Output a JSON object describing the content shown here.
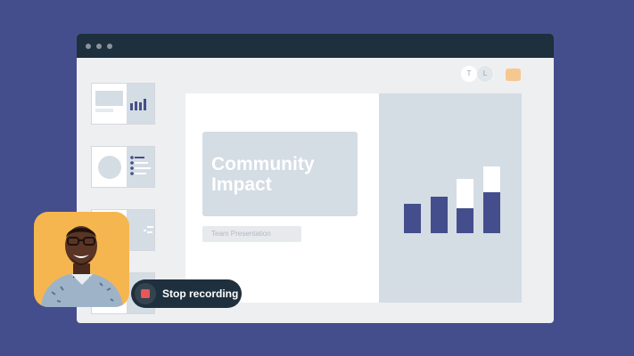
{
  "colors": {
    "background": "#454e8c",
    "window": "#eeeff1",
    "titlebar": "#1e2f3d",
    "slide_accent": "#d4dce4",
    "bar_dark": "#454e8c",
    "bar_light": "#ffffff",
    "record_red": "#e8565a",
    "webcam_bg": "#f6b64f"
  },
  "collaborators": [
    {
      "initial": "T"
    },
    {
      "initial": "L"
    }
  ],
  "slide": {
    "title": "Community Impact",
    "subtitle": "Team Presentation"
  },
  "recording": {
    "button_label": "Stop recording",
    "icon": "stop-icon"
  },
  "webcam": {
    "icon": "presenter-video"
  }
}
